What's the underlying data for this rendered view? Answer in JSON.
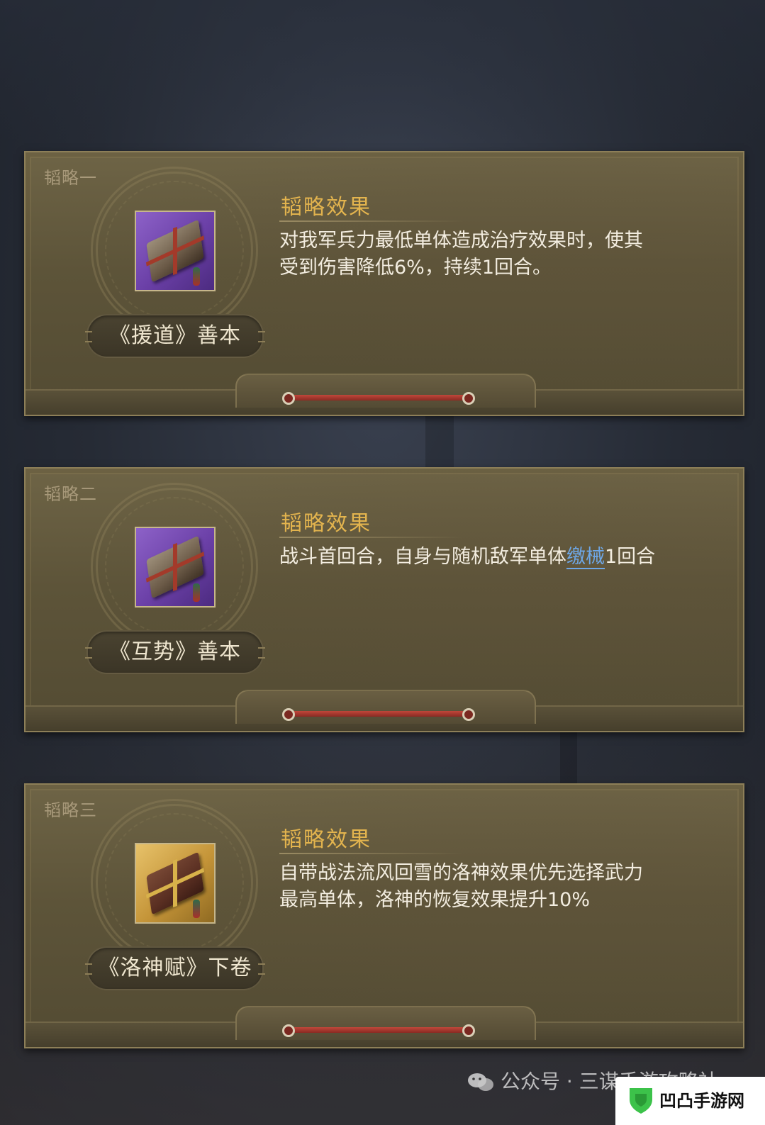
{
  "cards": [
    {
      "slot_label": "韬略一",
      "book_name": "《援道》善本",
      "effect_title": "韬略效果",
      "effect_lines": [
        "对我军兵力最低单体造成治疗效果时，使其",
        "受到伤害降低6%，持续1回合。"
      ]
    },
    {
      "slot_label": "韬略二",
      "book_name": "《互势》善本",
      "effect_title": "韬略效果",
      "effect_pre": "战斗首回合，自身与随机敌军单体",
      "effect_keyword": "缴械",
      "effect_post": "1回合"
    },
    {
      "slot_label": "韬略三",
      "book_name": "《洛神赋》下卷",
      "effect_title": "韬略效果",
      "effect_lines": [
        "自带战法流风回雪的洛神效果优先选择武力",
        "最高单体，洛神的恢复效果提升10%"
      ]
    }
  ],
  "colors": {
    "card_bg": "#5d5439",
    "effect_title": "#e3b44e",
    "keyword": "#6ea7e6",
    "cord": "#c0473a"
  },
  "watermark": {
    "text": "公众号 · 三谋手游攻略社"
  },
  "brand": {
    "text": "凹凸手游网"
  }
}
